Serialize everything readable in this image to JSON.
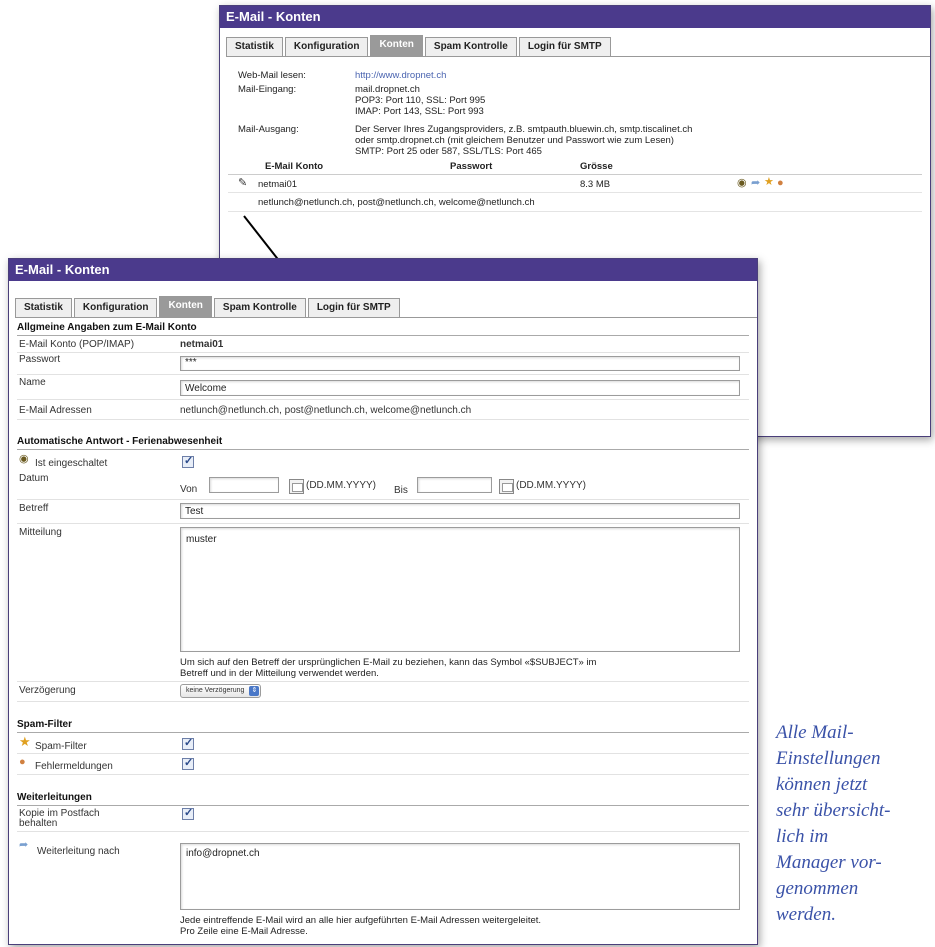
{
  "back_panel": {
    "title": "E-Mail - Konten",
    "tabs": [
      "Statistik",
      "Konfiguration",
      "Konten",
      "Spam Kontrolle",
      "Login für SMTP"
    ],
    "webmail_label": "Web-Mail lesen:",
    "webmail_link": "http://www.dropnet.ch",
    "incoming_label": "Mail-Eingang:",
    "incoming_lines": [
      "mail.dropnet.ch",
      "POP3: Port 110, SSL: Port 995",
      "IMAP: Port 143, SSL: Port 993"
    ],
    "outgoing_label": "Mail-Ausgang:",
    "outgoing_lines": [
      "Der Server Ihres Zugangsproviders, z.B. smtpauth.bluewin.ch, smtp.tiscalinet.ch",
      "oder smtp.dropnet.ch (mit gleichem Benutzer und Passwort wie zum Lesen)",
      "SMTP: Port 25 oder 587, SSL/TLS: Port 465"
    ],
    "col_account": "E-Mail Konto",
    "col_password": "Passwort",
    "col_size": "Grösse",
    "account_name": "netmai01",
    "account_size": "8.3 MB",
    "account_aliases": "netlunch@netlunch.ch, post@netlunch.ch, welcome@netlunch.ch"
  },
  "front_panel": {
    "title": "E-Mail - Konten",
    "tabs": [
      "Statistik",
      "Konfiguration",
      "Konten",
      "Spam Kontrolle",
      "Login für SMTP"
    ],
    "general": {
      "heading": "Allgmeine Angaben zum E-Mail Konto",
      "account_label": "E-Mail Konto (POP/IMAP)",
      "account_value": "netmai01",
      "password_label": "Passwort",
      "password_value": "***",
      "name_label": "Name",
      "name_value": "Welcome",
      "addresses_label": "E-Mail Adressen",
      "addresses_value": "netlunch@netlunch.ch, post@netlunch.ch, welcome@netlunch.ch"
    },
    "autoreply": {
      "heading": "Automatische Antwort - Ferienabwesenheit",
      "enabled_label": "Ist eingeschaltet",
      "date_label": "Datum",
      "from_label": "Von",
      "date_format_1": "(DD.MM.YYYY)",
      "to_label": "Bis",
      "date_format_2": "(DD.MM.YYYY)",
      "subject_label": "Betreff",
      "subject_value": "Test",
      "message_label": "Mitteilung",
      "message_value": "muster",
      "hint_line1": "Um sich auf den Betreff der ursprünglichen E-Mail zu beziehen, kann das Symbol «$SUBJECT» im",
      "hint_line2": "Betreff und in der Mitteilung verwendet werden.",
      "delay_label": "Verzögerung",
      "delay_value": "keine Verzögerung"
    },
    "spam": {
      "heading": "Spam-Filter",
      "filter_label": "Spam-Filter",
      "errors_label": "Fehlermeldungen"
    },
    "forwarding": {
      "heading": "Weiterleitungen",
      "copy_label_1": "Kopie im Postfach",
      "copy_label_2": "behalten",
      "forward_label": "Weiterleitung nach",
      "forward_value": "info@dropnet.ch",
      "hint_line1": "Jede eintreffende E-Mail wird an alle hier aufgeführten E-Mail Adressen weitergeleitet.",
      "hint_line2": "Pro Zeile eine E-Mail Adresse."
    }
  },
  "caption": [
    "Alle Mail-",
    "Einstellungen",
    "können jetzt",
    "sehr übersicht-",
    "lich im",
    "Manager vor-",
    "genommen",
    "werden."
  ]
}
